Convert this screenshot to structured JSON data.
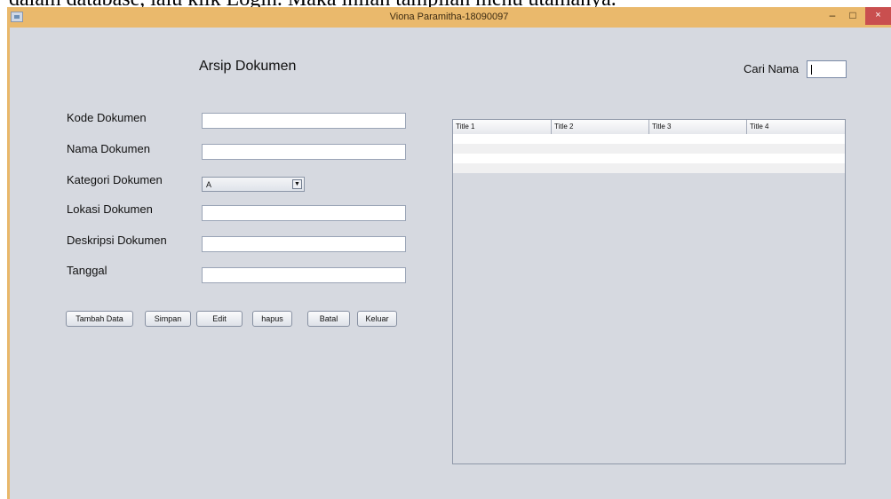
{
  "document_text": "dalam database, lalu klik Login. Maka inilah tampilan menu utamanya.",
  "window": {
    "title": "Viona Paramitha-18090097",
    "controls": {
      "minimize": "–",
      "maximize": "□",
      "close": "×"
    }
  },
  "form": {
    "heading": "Arsip Dokumen",
    "search_label": "Cari Nama",
    "search_value": "",
    "fields": [
      {
        "label": "Kode Dokumen",
        "value": ""
      },
      {
        "label": "Nama Dokumen",
        "value": ""
      },
      {
        "label": "Kategori Dokumen",
        "value": "A"
      },
      {
        "label": "Lokasi Dokumen",
        "value": ""
      },
      {
        "label": "Deskripsi Dokumen",
        "value": ""
      },
      {
        "label": "Tanggal",
        "value": ""
      }
    ],
    "buttons": [
      "Tambah Data",
      "Simpan",
      "Edit",
      "hapus",
      "Batal",
      "Keluar"
    ]
  },
  "table": {
    "columns": [
      "Title 1",
      "Title 2",
      "Title 3",
      "Title 4"
    ],
    "rows": [
      [
        "",
        "",
        "",
        ""
      ],
      [
        "",
        "",
        "",
        ""
      ],
      [
        "",
        "",
        "",
        ""
      ],
      [
        "",
        "",
        "",
        ""
      ]
    ]
  }
}
